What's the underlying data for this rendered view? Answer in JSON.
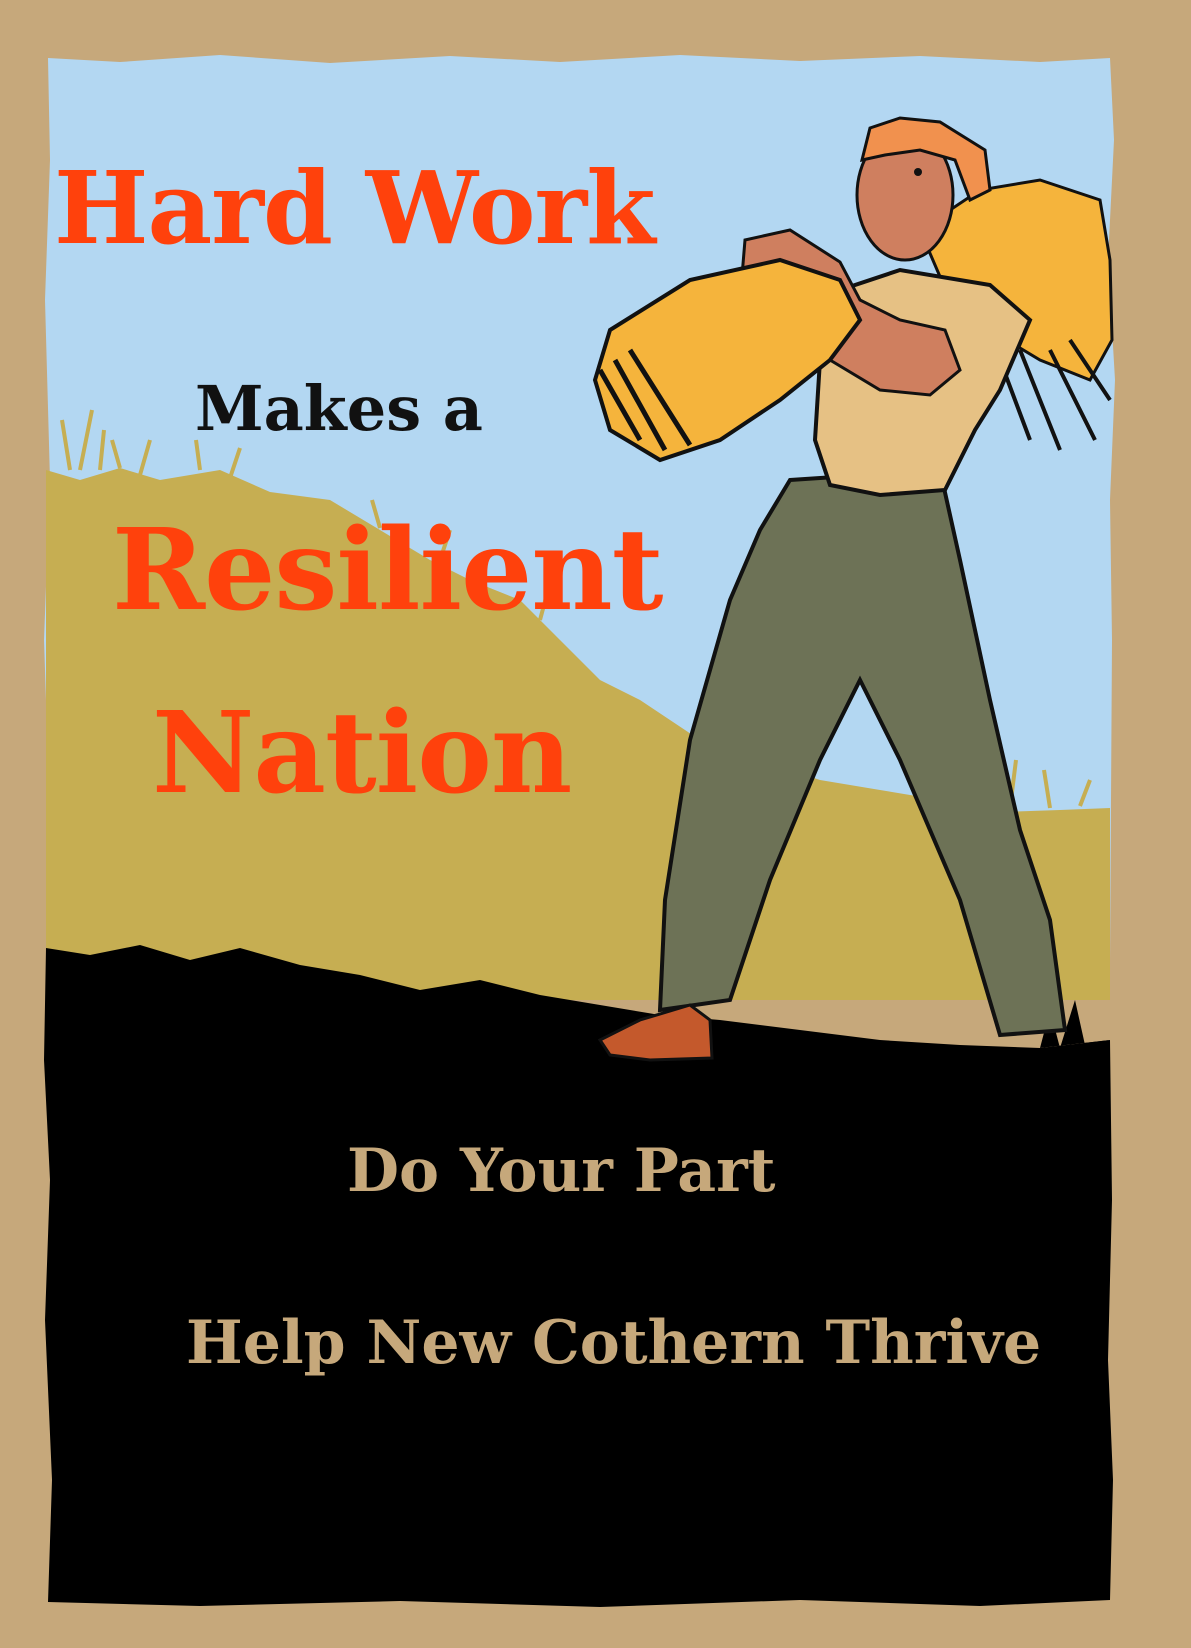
{
  "poster": {
    "headline": {
      "line1": "Hard Work",
      "line2": "Makes a",
      "line3": "Resilient",
      "line4": "Nation"
    },
    "taglines": {
      "line1": "Do Your Part",
      "line2": "Help New Cothern Thrive"
    }
  },
  "colors": {
    "frame": "#c6a87b",
    "sky": "#b3d7f2",
    "hill": "#c6ae52",
    "ground": "#000000",
    "headline_accent": "#ff410c",
    "headline_dark": "#111111",
    "tagline": "#c6a87b",
    "trousers": "#6d7256",
    "shirt": "#e6c184",
    "skin": "#cf7f5f",
    "hair": "#f1914e",
    "wheat": "#f5b43c"
  }
}
